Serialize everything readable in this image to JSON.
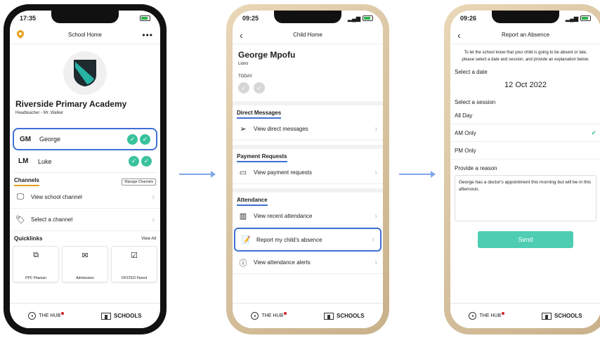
{
  "phone1": {
    "time": "17:35",
    "title": "School Home",
    "more": "•••",
    "school_name": "Riverside Primary Academy",
    "headteacher": "Headteacher - Mr. Walker",
    "children": [
      {
        "initials": "GM",
        "name": "George"
      },
      {
        "initials": "LM",
        "name": "Luke"
      }
    ],
    "channels": {
      "title": "Channels",
      "manage": "Manage Channels",
      "items": [
        "View school channel",
        "Select a channel"
      ]
    },
    "quicklinks": {
      "title": "Quicklinks",
      "view_all": "View All",
      "items": [
        "PPC Pitanian",
        "Admissions",
        "OFSTED Parent"
      ]
    }
  },
  "phone2": {
    "time": "09:25",
    "title": "Child Home",
    "child_name": "George Mpofu",
    "house": "Lions",
    "today": "TODAY",
    "direct_messages": {
      "title": "Direct Messages",
      "item": "View direct messages"
    },
    "payment_requests": {
      "title": "Payment Requests",
      "item": "View payment requests"
    },
    "attendance": {
      "title": "Attendance",
      "items": [
        "View recent attendance",
        "Report my child's absence",
        "View attendance alerts"
      ]
    }
  },
  "phone3": {
    "time": "09:26",
    "title": "Report an Absence",
    "intro": "To let the school know that your child is going to be absent or late, please select a date and session, and provide an explanation below.",
    "select_date": "Select a date",
    "date": "12 Oct 2022",
    "select_session": "Select a session",
    "sessions": [
      "All Day",
      "AM Only",
      "PM Only"
    ],
    "selected_session": "AM Only",
    "provide_reason": "Provide a reason",
    "reason_text": "George has a doctor's appointment this morning but will be in this afternoon.",
    "send": "Send"
  },
  "tabbar": {
    "hub": "THE HUB",
    "schools": "SCHOOLS"
  },
  "colors": {
    "highlight": "#3f6fd4",
    "teal": "#39c29c",
    "send": "#4ecdb2",
    "accent": "#e3a21a"
  }
}
